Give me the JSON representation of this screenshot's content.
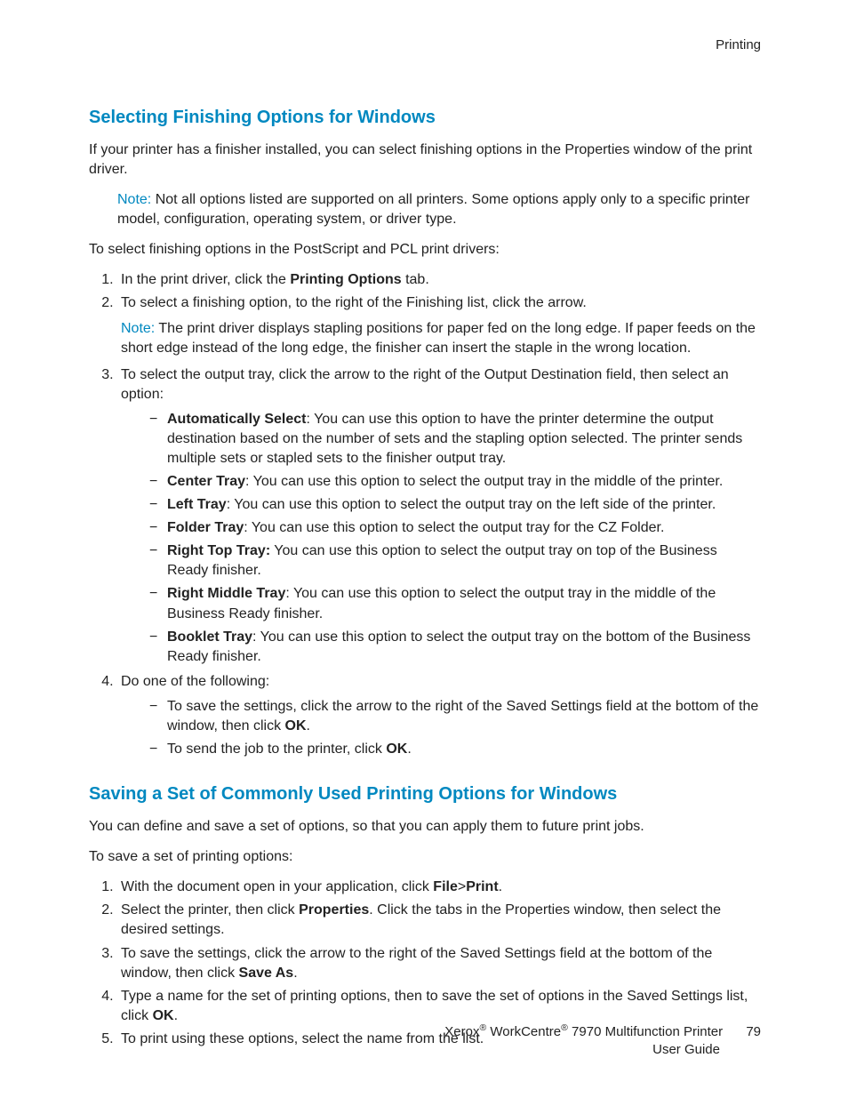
{
  "header": {
    "section": "Printing"
  },
  "body": {
    "h1": "Selecting Finishing Options for Windows",
    "p1": "If your printer has a finisher installed, you can select finishing options in the Properties window of the print driver.",
    "note1_label": "Note:",
    "note1": " Not all options listed are supported on all printers. Some options apply only to a specific printer model, configuration, operating system, or driver type.",
    "p2": "To select finishing options in the PostScript and PCL print drivers:",
    "s1_li1_a": "In the print driver, click the ",
    "s1_li1_b": "Printing Options",
    "s1_li1_c": " tab.",
    "s1_li2": "To select a finishing option, to the right of the Finishing list, click the arrow.",
    "note2_label": "Note:",
    "note2": " The print driver displays stapling positions for paper fed on the long edge. If paper feeds on the short edge instead of the long edge, the finisher can insert the staple in the wrong location.",
    "s1_li3": "To select the output tray, click the arrow to the right of the Output Destination field, then select an option:",
    "opt1_b": "Automatically Select",
    "opt1_t": ": You can use this option to have the printer determine the output destination based on the number of sets and the stapling option selected. The printer sends multiple sets or stapled sets to the finisher output tray.",
    "opt2_b": "Center Tray",
    "opt2_t": ": You can use this option to select the output tray in the middle of the printer.",
    "opt3_b": "Left Tray",
    "opt3_t": ": You can use this option to select the output tray on the left side of the printer.",
    "opt4_b": "Folder Tray",
    "opt4_t": ": You can use this option to select the output tray for the CZ Folder.",
    "opt5_b": "Right Top Tray:",
    "opt5_t": " You can use this option to select the output tray on top of the Business Ready finisher.",
    "opt6_b": "Right Middle Tray",
    "opt6_t": ": You can use this option to select the output tray in the middle of the Business Ready finisher.",
    "opt7_b": "Booklet Tray",
    "opt7_t": ": You can use this option to select the output tray on the bottom of the Business Ready finisher.",
    "s1_li4": "Do one of the following:",
    "do1_a": "To save the settings, click the arrow to the right of the Saved Settings field at the bottom of the window, then click ",
    "do1_b": "OK",
    "do1_c": ".",
    "do2_a": "To send the job to the printer, click ",
    "do2_b": "OK",
    "do2_c": ".",
    "h2": "Saving a Set of Commonly Used Printing Options for Windows",
    "p3": "You can define and save a set of options, so that you can apply them to future print jobs.",
    "p4": "To save a set of printing options:",
    "s2_li1_a": "With the document open in your application, click ",
    "s2_li1_b": "File",
    "s2_li1_c": ">",
    "s2_li1_d": "Print",
    "s2_li1_e": ".",
    "s2_li2_a": "Select the printer, then click ",
    "s2_li2_b": "Properties",
    "s2_li2_c": ". Click the tabs in the Properties window, then select the desired settings.",
    "s2_li3_a": "To save the settings, click the arrow to the right of the Saved Settings field at the bottom of the window, then click ",
    "s2_li3_b": "Save As",
    "s2_li3_c": ".",
    "s2_li4_a": "Type a name for the set of printing options, then to save the set of options in the Saved Settings list, click ",
    "s2_li4_b": "OK",
    "s2_li4_c": ".",
    "s2_li5": "To print using these options, select the name from the list."
  },
  "footer": {
    "line1_a": "Xerox",
    "line1_b": " WorkCentre",
    "line1_c": " 7970 Multifunction Printer",
    "line2": "User Guide",
    "page": "79"
  }
}
